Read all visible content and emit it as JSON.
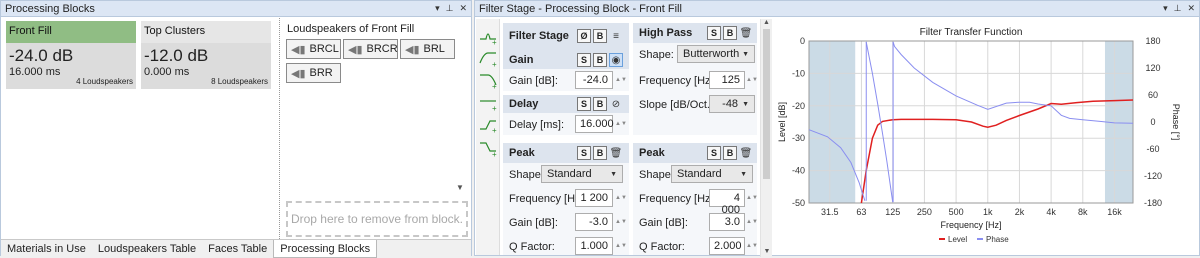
{
  "left": {
    "title": "Processing Blocks",
    "cards": [
      {
        "name": "Front Fill",
        "level": "-24.0 dB",
        "delay": "16.000 ms",
        "count": "4 Loudspeakers"
      },
      {
        "name": "Top Clusters",
        "level": "-12.0 dB",
        "delay": "0.000 ms",
        "count": "8 Loudspeakers"
      }
    ],
    "ls_title": "Loudspeakers of Front Fill",
    "speakers": [
      "BRCL",
      "BRCR",
      "BRL",
      "BRR"
    ],
    "drop_hint": "Drop here to remove from block.",
    "tabs": [
      "Materials in Use",
      "Loudspeakers Table",
      "Faces Table",
      "Processing Blocks"
    ]
  },
  "right": {
    "title": "Filter Stage - Processing Block - Front Fill",
    "filter_stage": {
      "label": "Filter Stage",
      "phase_btn": "Ø",
      "bypass_btn": "B"
    },
    "solo": "S",
    "bypass": "B",
    "gain": {
      "label": "Gain",
      "field": "Gain [dB]:",
      "value": "-24.0"
    },
    "delay": {
      "label": "Delay",
      "field": "Delay [ms]:",
      "value": "16.000"
    },
    "highpass": {
      "label": "High Pass",
      "shape_label": "Shape:",
      "shape": "Butterworth",
      "freq_label": "Frequency [Hz]:",
      "freq": "125",
      "slope_label": "Slope [dB/Oct.]:",
      "slope": "-48"
    },
    "peak1": {
      "label": "Peak",
      "shape_label": "Shape:",
      "shape": "Standard",
      "freq_label": "Frequency [Hz]:",
      "freq": "1 200",
      "gain_label": "Gain [dB]:",
      "gain": "-3.0",
      "q_label": "Q Factor:",
      "q": "1.000"
    },
    "peak2": {
      "label": "Peak",
      "shape_label": "Shape:",
      "shape": "Standard",
      "freq_label": "Frequency [Hz]:",
      "freq": "4 000",
      "gain_label": "Gain [dB]:",
      "gain": "3.0",
      "q_label": "Q Factor:",
      "q": "2.000"
    }
  },
  "chart_data": {
    "type": "line",
    "title": "Filter Transfer Function",
    "xlabel": "Frequency [Hz]",
    "ylabel": "Level [dB]",
    "y2label": "Phase [°]",
    "x_scale": "log",
    "x_ticks": [
      "31.5",
      "63",
      "125",
      "250",
      "500",
      "1k",
      "2k",
      "4k",
      "8k",
      "16k"
    ],
    "x_tick_values": [
      31.5,
      63,
      125,
      250,
      500,
      1000,
      2000,
      4000,
      8000,
      16000
    ],
    "xlim": [
      20,
      24000
    ],
    "ylim": [
      -50,
      0
    ],
    "y_ticks": [
      "0",
      "-10",
      "-20",
      "-30",
      "-40",
      "-50"
    ],
    "y2lim": [
      -180,
      180
    ],
    "y2_ticks": [
      "180",
      "120",
      "60",
      "0",
      "-60",
      "-120",
      "-180"
    ],
    "shaded_ranges": [
      [
        20,
        55
      ],
      [
        13000,
        24000
      ]
    ],
    "grid": true,
    "legend_position": "bottom",
    "series": [
      {
        "name": "Level",
        "color": "#e02020",
        "axis": "left",
        "x": [
          63,
          70,
          80,
          90,
          100,
          125,
          150,
          200,
          300,
          500,
          700,
          900,
          1000,
          1200,
          1500,
          2000,
          3000,
          4000,
          5000,
          7000,
          10000,
          16000,
          24000
        ],
        "y": [
          -50,
          -40,
          -30,
          -26,
          -24.8,
          -24.3,
          -24.2,
          -24.2,
          -24.2,
          -24.3,
          -25,
          -26.3,
          -26.6,
          -26,
          -24.5,
          -23,
          -21,
          -19.3,
          -19.5,
          -19,
          -18.6,
          -18.4,
          -18.2
        ]
      },
      {
        "name": "Phase",
        "color": "#8a8ef0",
        "axis": "right",
        "x": [
          20,
          30,
          40,
          50,
          60,
          68,
          70,
          80,
          90,
          100,
          110,
          120,
          125,
          126,
          130,
          150,
          200,
          300,
          500,
          800,
          1000,
          1500,
          2000,
          2500,
          3000,
          4000,
          5000,
          6000,
          8000,
          12000,
          16000,
          24000
        ],
        "y": [
          -17,
          -33,
          -57,
          -90,
          -135,
          -175,
          178,
          108,
          40,
          -25,
          -88,
          -150,
          -178,
          178,
          168,
          150,
          120,
          88,
          58,
          37,
          28,
          42,
          44,
          44,
          40,
          36,
          15,
          8,
          5,
          1,
          -2,
          -3
        ]
      }
    ]
  }
}
